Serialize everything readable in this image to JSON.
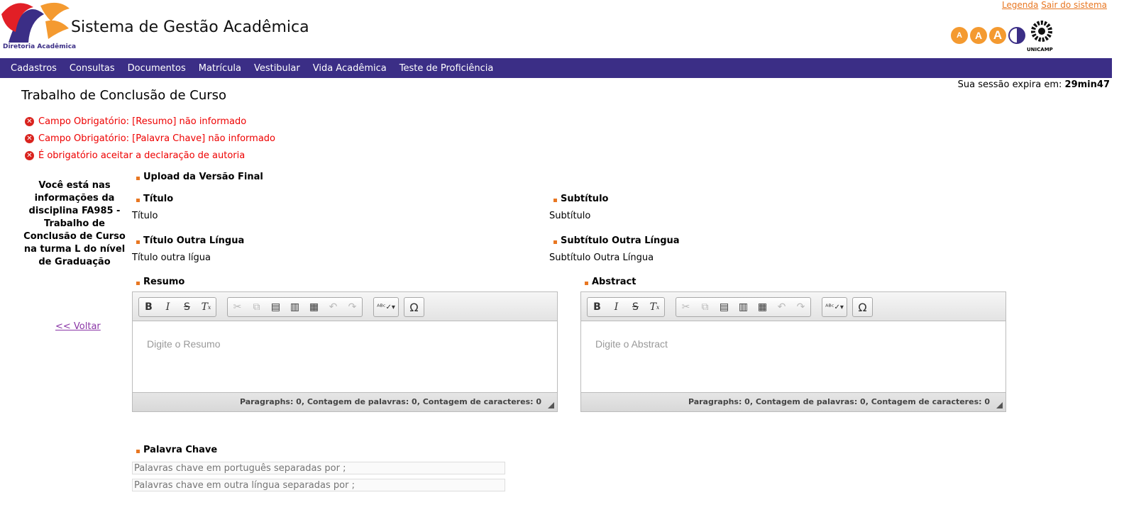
{
  "header": {
    "logo_text": "Diretoria Acadêmica",
    "system_title": "Sistema de Gestão Acadêmica",
    "links": [
      "Legenda",
      "Sair do sistema"
    ],
    "font_buttons": [
      "A",
      "A",
      "A"
    ],
    "unicamp_label": "UNICAMP"
  },
  "menu": [
    "Cadastros",
    "Consultas",
    "Documentos",
    "Matrícula",
    "Vestibular",
    "Vida Acadêmica",
    "Teste de Proficiência"
  ],
  "session": {
    "label": "Sua sessão expira em:",
    "value": "29min47"
  },
  "page_title": "Trabalho de Conclusão de Curso",
  "errors": [
    "Campo Obrigatório: [Resumo] não informado",
    "Campo Obrigatório: [Palavra Chave] não informado",
    "É obrigatório aceitar a declaração de autoria"
  ],
  "side_info": "Você está nas informações da disciplina FA985 - Trabalho de Conclusão de Curso na turma L do nível de Graduação",
  "back_link": "<< Voltar",
  "sections": {
    "upload": "Upload da Versão Final",
    "titulo": {
      "label": "Título",
      "value": "Título"
    },
    "subtitulo": {
      "label": "Subtítulo",
      "value": "Subtítulo"
    },
    "titulo_outra": {
      "label": "Título Outra Língua",
      "value": "Título outra lígua"
    },
    "subtitulo_outra": {
      "label": "Subtítulo Outra Língua",
      "value": "Subtítulo Outra Língua"
    },
    "resumo": {
      "label": "Resumo",
      "placeholder": "Digite o Resumo",
      "status": "Paragraphs: 0, Contagem de palavras: 0, Contagem de caracteres: 0"
    },
    "abstract": {
      "label": "Abstract",
      "placeholder": "Digite o Abstract",
      "status": "Paragraphs: 0, Contagem de palavras: 0, Contagem de caracteres: 0"
    },
    "palavra_chave": {
      "label": "Palavra Chave",
      "pt_placeholder": "Palavras chave em português separadas por ;",
      "other_placeholder": "Palavras chave em outra língua separadas por ;"
    }
  },
  "toolbar_icons": [
    "bold-icon",
    "italic-icon",
    "strikethrough-icon",
    "remove-format-icon",
    "cut-icon",
    "copy-icon",
    "paste-icon",
    "paste-text-icon",
    "paste-word-icon",
    "undo-icon",
    "redo-icon",
    "spellcheck-icon",
    "special-char-icon"
  ],
  "colors": {
    "menu_bg": "#3b2e86",
    "accent": "#e87722",
    "error": "#e00000"
  }
}
